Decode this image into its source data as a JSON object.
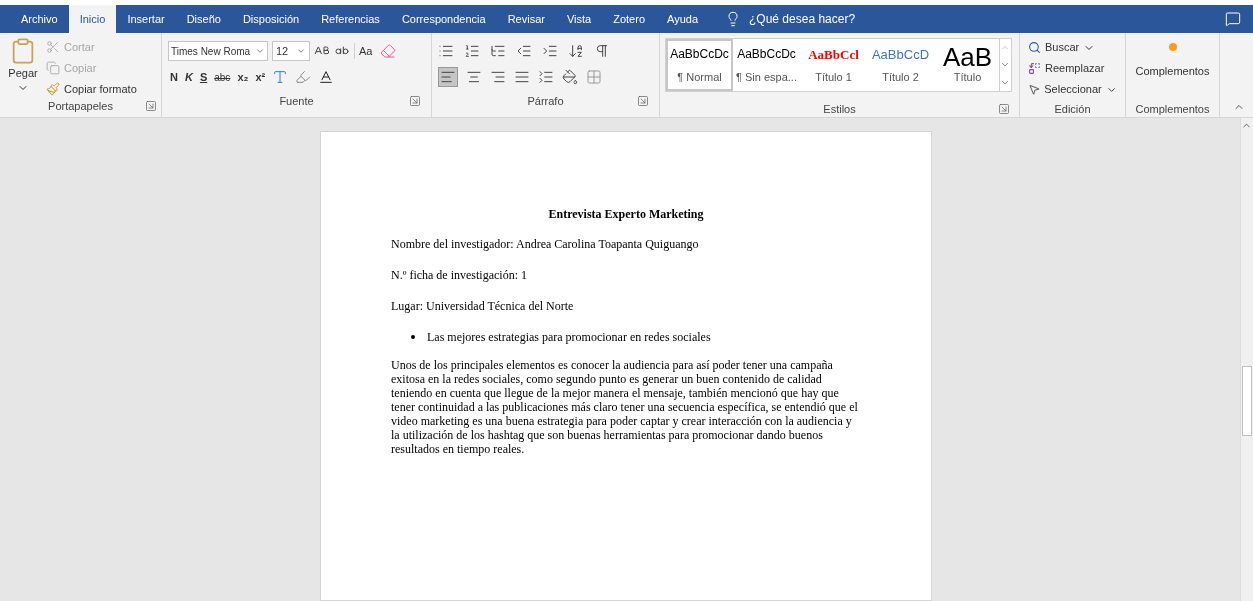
{
  "tabs": [
    {
      "label": "Archivo",
      "selected": false
    },
    {
      "label": "Inicio",
      "selected": true
    },
    {
      "label": "Insertar",
      "selected": false
    },
    {
      "label": "Diseño",
      "selected": false
    },
    {
      "label": "Disposición",
      "selected": false
    },
    {
      "label": "Referencias",
      "selected": false
    },
    {
      "label": "Correspondencia",
      "selected": false
    },
    {
      "label": "Revisar",
      "selected": false
    },
    {
      "label": "Vista",
      "selected": false
    },
    {
      "label": "Zotero",
      "selected": false
    },
    {
      "label": "Ayuda",
      "selected": false
    }
  ],
  "tell_me": "¿Qué desea hacer?",
  "clipboard": {
    "paste": "Pegar",
    "cut": {
      "label": "Cortar",
      "disabled": true
    },
    "copy": {
      "label": "Copiar",
      "disabled": true
    },
    "format_painter": {
      "label": "Copiar formato",
      "disabled": false
    },
    "group": "Portapapeles"
  },
  "font": {
    "name": "Times New Roma",
    "size": "12",
    "change_case": "Aa",
    "format_buttons": [
      "N",
      "K",
      "S"
    ],
    "strikethrough": "abc",
    "subscript": "x₂",
    "superscript": "x²",
    "group": "Fuente"
  },
  "paragraph": {
    "align_left_selected": true,
    "group": "Párrafo"
  },
  "styles": {
    "items": [
      {
        "preview": "AaBbCcDc",
        "name": "¶ Normal",
        "kind": "body",
        "color": "#000000",
        "selected": true
      },
      {
        "preview": "AaBbCcDc",
        "name": "¶ Sin espa...",
        "kind": "body",
        "color": "#000000",
        "selected": false
      },
      {
        "preview": "AaBbCcl",
        "name": "Título 1",
        "kind": "heading",
        "color": "#ff0000",
        "selected": false
      },
      {
        "preview": "AaBbCcD",
        "name": "Título 2",
        "kind": "subheading",
        "color": "#4472c4",
        "selected": false
      },
      {
        "preview": "AaB",
        "name": "Título",
        "kind": "title",
        "color": "#000000",
        "selected": false
      }
    ],
    "group": "Estilos"
  },
  "editing": {
    "find": "Buscar",
    "replace": "Reemplazar",
    "select": "Seleccionar",
    "group": "Edición"
  },
  "addins": {
    "button": "Complementos",
    "group": "Complementos"
  },
  "document": {
    "title": "Entrevista Experto Marketing",
    "fields": [
      "Nombre del investigador: Andrea Carolina Toapanta Quiguango",
      "N.º ficha de investigación: 1",
      "Lugar: Universidad Técnica del Norte"
    ],
    "bullets": [
      "Las mejores estrategias para promocionar en redes sociales"
    ],
    "paragraph": "Unos de los principales elementos es conocer la audiencia para así poder tener una campaña exitosa en la redes sociales, como segundo punto es generar un buen contenido de calidad teniendo en cuenta que llegue de la mejor manera el mensaje, también mencionó que hay que tener continuidad a las publicaciones más claro tener una secuencia específica, se entendió que el video marketing es una buena estrategia para poder captar y crear interacción con la audiencia y la utilización de los hashtag que son buenas herramientas para promocionar dando buenos resultados en tiempo reales."
  }
}
